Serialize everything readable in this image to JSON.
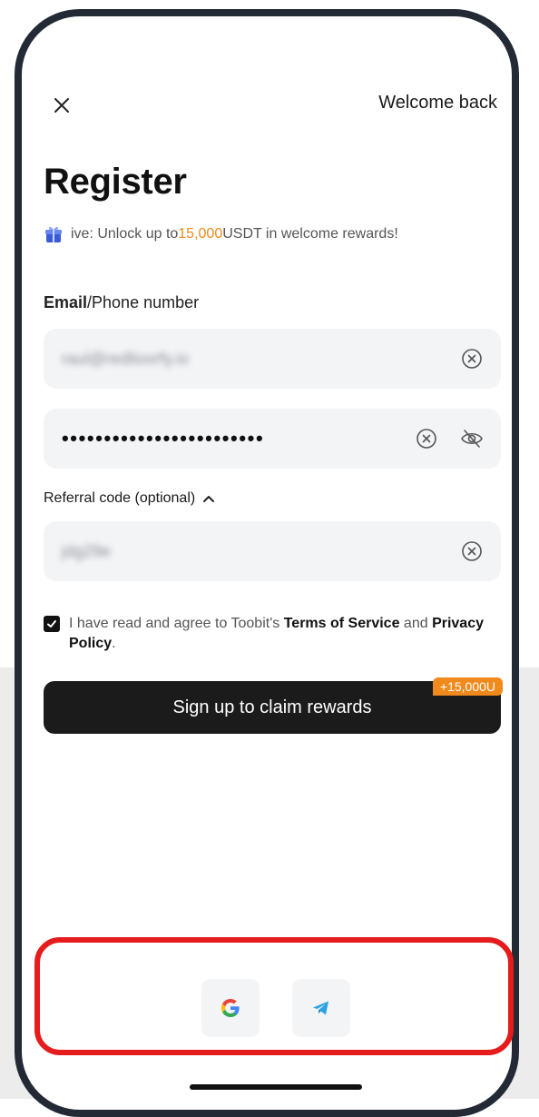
{
  "header": {
    "close_icon": "close-icon",
    "welcome_link": "Welcome back"
  },
  "page": {
    "title": "Register",
    "promo_icon": "gift-icon",
    "promo_prefix": "ive: Unlock up to ",
    "promo_amount": "15,000",
    "promo_suffix": " USDT in welcome rewards!",
    "accent_color": "#f08a1c"
  },
  "form": {
    "email_label_bold": "Email",
    "email_label_rest": "/Phone number",
    "email_value": "raul@redlioorfy.io",
    "password_value": "••••••••••••••••••••••••",
    "referral_label": "Referral code (optional)",
    "referral_value": "jdg29e",
    "agree_prefix": "I have read and agree to Toobit's ",
    "terms_link": "Terms of Service",
    "agree_mid": " and ",
    "privacy_link": "Privacy Policy",
    "agree_end": ".",
    "submit_label": "Sign up to claim rewards",
    "bonus_tag": "+15,000U"
  },
  "social": {
    "google_icon": "google-icon",
    "telegram_icon": "telegram-icon",
    "highlight_color": "#e61c1c"
  }
}
